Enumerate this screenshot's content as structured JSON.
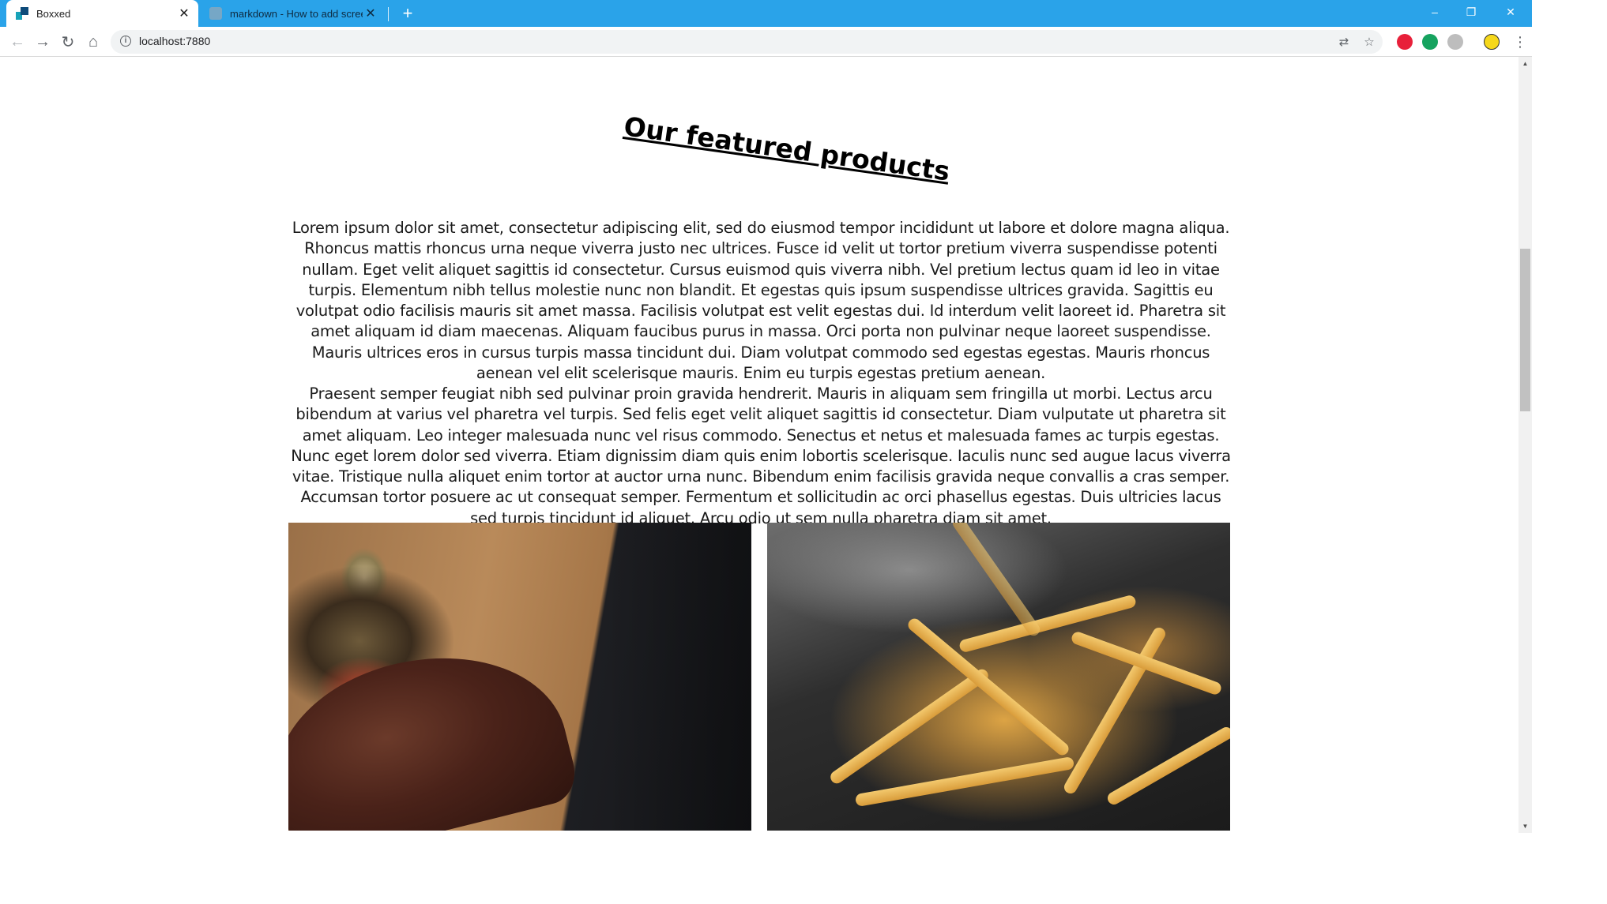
{
  "browser": {
    "tabs": [
      {
        "title": "Boxxed",
        "active": true
      },
      {
        "title": "markdown - How to add screens",
        "active": false
      }
    ],
    "new_tab_label": "+",
    "window_controls": {
      "minimize": "–",
      "restore": "❐",
      "close": "✕"
    },
    "close_tab_glyph": "✕",
    "nav": {
      "back_icon": "←",
      "forward_icon": "→",
      "reload_icon": "↻",
      "home_icon": "⌂"
    },
    "address": "localhost:7880",
    "omnibox_icons": {
      "translate": "⇄",
      "bookmark": "☆",
      "menu": "⋮"
    },
    "extension_colors": [
      "#e8203a",
      "#16a35f",
      "#bdbdbd",
      "#f6d81b"
    ]
  },
  "page": {
    "heading": "Our featured products",
    "paragraphs": [
      "Lorem ipsum dolor sit amet, consectetur adipiscing elit, sed do eiusmod tempor incididunt ut labore et dolore magna aliqua. Rhoncus mattis rhoncus urna neque viverra justo nec ultrices. Fusce id velit ut tortor pretium viverra suspendisse potenti nullam. Eget velit aliquet sagittis id consectetur. Cursus euismod quis viverra nibh. Vel pretium lectus quam id leo in vitae turpis. Elementum nibh tellus molestie nunc non blandit. Et egestas quis ipsum suspendisse ultrices gravida. Sagittis eu volutpat odio facilisis mauris sit amet massa. Facilisis volutpat est velit egestas dui. Id interdum velit laoreet id. Pharetra sit amet aliquam id diam maecenas. Aliquam faucibus purus in massa. Orci porta non pulvinar neque laoreet suspendisse. Mauris ultrices eros in cursus turpis massa tincidunt dui. Diam volutpat commodo sed egestas egestas. Mauris rhoncus aenean vel elit scelerisque mauris. Enim eu turpis egestas pretium aenean.",
      "Praesent semper feugiat nibh sed pulvinar proin gravida hendrerit. Mauris in aliquam sem fringilla ut morbi. Lectus arcu bibendum at varius vel pharetra vel turpis. Sed felis eget velit aliquet sagittis id consectetur. Diam vulputate ut pharetra sit amet aliquam. Leo integer malesuada nunc vel risus commodo. Senectus et netus et malesuada fames ac turpis egestas. Nunc eget lorem dolor sed viverra. Etiam dignissim diam quis enim lobortis scelerisque. Iaculis nunc sed augue lacus viverra vitae. Tristique nulla aliquet enim tortor at auctor urna nunc. Bibendum enim facilisis gravida neque convallis a cras semper. Accumsan tortor posuere ac ut consequat semper. Fermentum et sollicitudin ac orci phasellus egestas. Duis ultricies lacus sed turpis tincidunt id aliquet. Arcu odio ut sem nulla pharetra diam sit amet."
    ]
  },
  "scrollbar": {
    "up_arrow": "▲",
    "down_arrow": "▼"
  }
}
